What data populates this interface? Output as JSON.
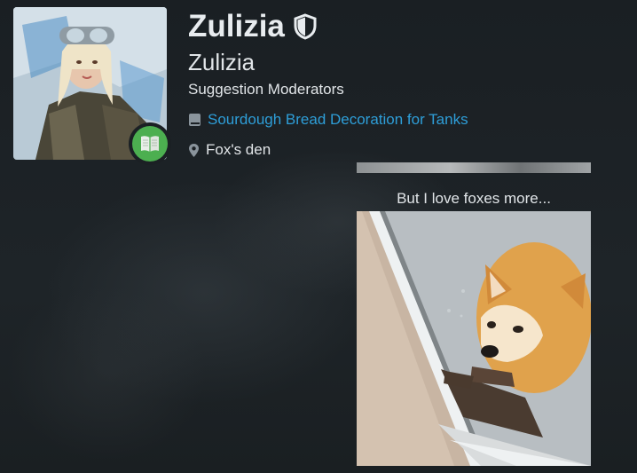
{
  "profile": {
    "username": "Zulizia",
    "display_name": "Zulizia",
    "role": "Suggestion Moderators",
    "book_link": "Sourdough Bread Decoration for Tanks",
    "location": "Fox's den"
  },
  "signature": {
    "caption": "But I love foxes more..."
  },
  "icons": {
    "verified": "shield-icon",
    "badge": "book-icon",
    "book_link": "book-icon",
    "location": "map-pin-icon"
  },
  "colors": {
    "background": "#1b2024",
    "link": "#2e9ed8",
    "badge": "#4caf50",
    "text": "#e1e5e8"
  }
}
